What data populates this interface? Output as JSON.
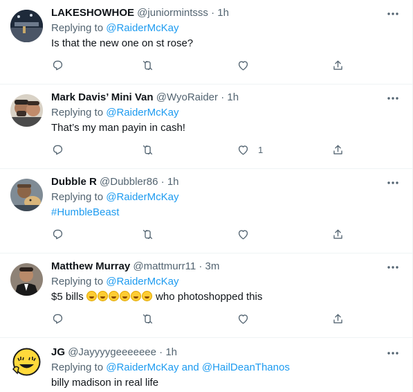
{
  "tweets": [
    {
      "name": "LAKESHOWHOE",
      "handle": "@juniormintsss",
      "time": "1h",
      "replying_prefix": "Replying to",
      "mentions": [
        "@RaiderMcKay"
      ],
      "text": "Is that the new one on st rose?",
      "like_count": ""
    },
    {
      "name": "Mark Davis’ Mini Van",
      "handle": "@WyoRaider",
      "time": "1h",
      "replying_prefix": "Replying to",
      "mentions": [
        "@RaiderMcKay"
      ],
      "text": "That’s my man payin in cash!",
      "like_count": "1"
    },
    {
      "name": "Dubble R",
      "handle": "@Dubbler86",
      "time": "1h",
      "replying_prefix": "Replying to",
      "mentions": [
        "@RaiderMcKay"
      ],
      "text": "#HumbleBeast",
      "like_count": ""
    },
    {
      "name": "Matthew Murray",
      "handle": "@mattmurr11",
      "time": "3m",
      "replying_prefix": "Replying to",
      "mentions": [
        "@RaiderMcKay"
      ],
      "text_before_emoji": "$5 bills",
      "emoji_name": "rolling-on-floor-laughing",
      "emoji_count": 6,
      "text_after_emoji": "who photoshopped this",
      "like_count": ""
    },
    {
      "name": "JG",
      "handle": "@Jayyyygeeeeeee",
      "time": "1h",
      "replying_prefix": "Replying to",
      "mentions": [
        "@RaiderMcKay",
        "@HailDeanThanos"
      ],
      "mention_joiner": "and",
      "text": "billy madison in real life",
      "like_count": ""
    }
  ],
  "separator": "·",
  "icons": {
    "reply": "reply-icon",
    "retweet": "retweet-icon",
    "like": "heart-icon",
    "share": "share-icon",
    "more": "more-options-icon"
  },
  "colors": {
    "link": "#1d9bf0",
    "secondary_text": "#536471",
    "primary_text": "#0f1419",
    "divider": "#eff3f4",
    "icon": "#536471"
  }
}
